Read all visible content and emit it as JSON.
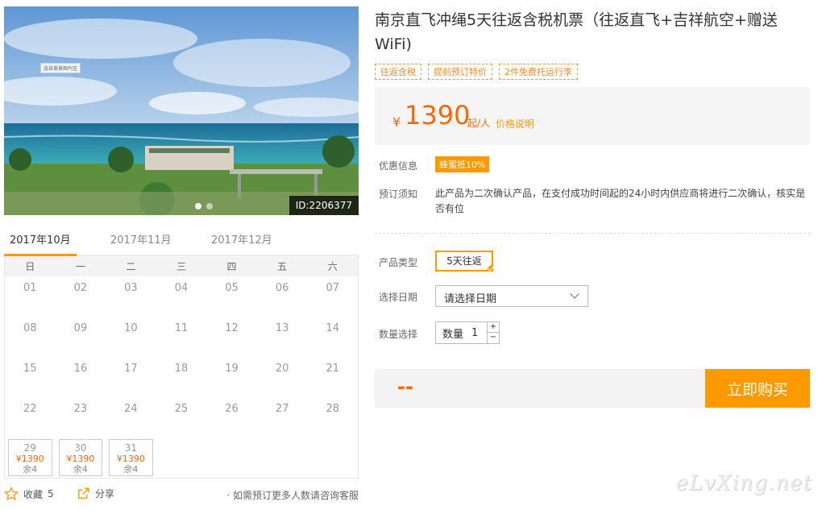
{
  "product": {
    "title": "南京直飞冲绳5天往返含税机票（往返直飞+吉祥航空+赠送WiFi)",
    "tags": [
      "往返含税",
      "提前预订特价",
      "2件免费托运行李"
    ]
  },
  "gallery": {
    "photo_tag": "选自美景图片区",
    "image_id": "ID:2206377"
  },
  "price": {
    "currency": "¥",
    "amount": "1390",
    "unit": "起/人",
    "explain_link": "价格说明"
  },
  "offer": {
    "label": "优惠信息",
    "badge": "蜂蜜抵10%"
  },
  "booking_notice": {
    "label": "预订须知",
    "text": "此产品为二次确认产品，在支付成功时间起的24小时内供应商将进行二次确认，核实是否有位"
  },
  "product_type": {
    "label": "产品类型",
    "option": "5天往返"
  },
  "date_select": {
    "label": "选择日期",
    "placeholder": "请选择日期"
  },
  "quantity": {
    "label": "数量选择",
    "field_label": "数量",
    "value": "1",
    "plus": "+",
    "minus": "−"
  },
  "total": {
    "price_placeholder": "--"
  },
  "buy_button": "立即购买",
  "calendar": {
    "months": [
      "2017年10月",
      "2017年11月",
      "2017年12月"
    ],
    "weekdays": [
      "日",
      "一",
      "二",
      "三",
      "四",
      "五",
      "六"
    ],
    "days": [
      "01",
      "02",
      "03",
      "04",
      "05",
      "06",
      "07",
      "08",
      "09",
      "10",
      "11",
      "12",
      "13",
      "14",
      "15",
      "16",
      "17",
      "18",
      "19",
      "20",
      "21",
      "22",
      "23",
      "24",
      "25",
      "26",
      "27",
      "28"
    ],
    "available": [
      {
        "day": "29",
        "price": "¥1390",
        "stock": "余4"
      },
      {
        "day": "30",
        "price": "¥1390",
        "stock": "余4"
      },
      {
        "day": "31",
        "price": "¥1390",
        "stock": "余4"
      }
    ]
  },
  "footer": {
    "favorite_label": "收藏",
    "favorite_count": "5",
    "share_label": "分享",
    "note": "· 如需预订更多人数请咨询客服"
  },
  "watermark": "eLvXing.net",
  "colors": {
    "accent": "#ff9900",
    "price": "#ff6600"
  }
}
